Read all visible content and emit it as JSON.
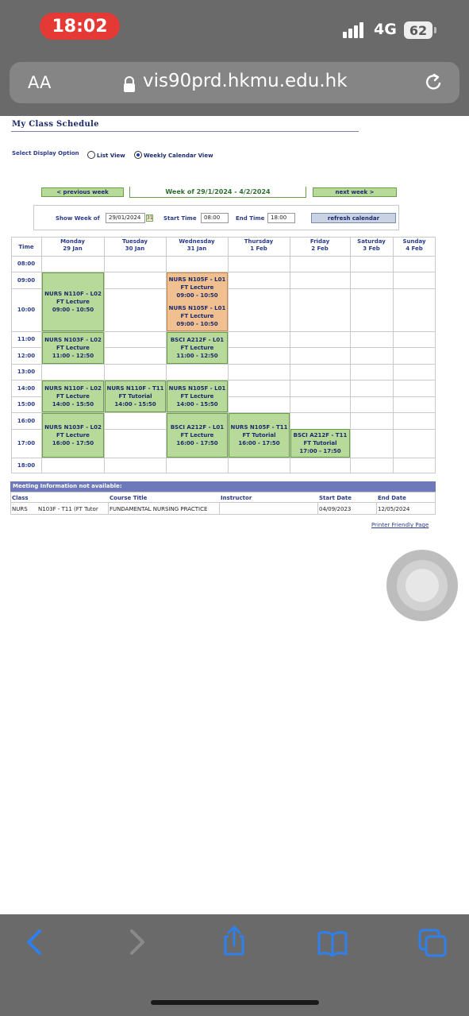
{
  "status_bar": {
    "time": "18:02",
    "network": "4G",
    "battery": "62"
  },
  "browser": {
    "text_size_label": "AA",
    "url": "vis90prd.hkmu.edu.hk"
  },
  "page": {
    "title": "My Class Schedule",
    "display_option_label": "Select Display Option",
    "list_view_label": "List View",
    "weekly_view_label": "Weekly Calendar View",
    "selected_view": "weekly",
    "prev_week_label": "< previous week",
    "week_label": "Week of 29/1/2024 - 4/2/2024",
    "next_week_label": "next week >",
    "show_week_label": "Show Week of",
    "show_week_value": "29/01/2024",
    "start_time_label": "Start Time",
    "start_time_value": "08:00",
    "end_time_label": "End Time",
    "end_time_value": "18:00",
    "refresh_label": "refresh calendar",
    "printer_label": "Printer Friendly Page"
  },
  "calendar": {
    "time_header": "Time",
    "days": [
      {
        "name": "Monday",
        "date": "29 Jan"
      },
      {
        "name": "Tuesday",
        "date": "30 Jan"
      },
      {
        "name": "Wednesday",
        "date": "31 Jan"
      },
      {
        "name": "Thursday",
        "date": "1 Feb"
      },
      {
        "name": "Friday",
        "date": "2 Feb"
      },
      {
        "name": "Saturday",
        "date": "3 Feb"
      },
      {
        "name": "Sunday",
        "date": "4 Feb"
      }
    ],
    "times": [
      "08:00",
      "09:00",
      "10:00",
      "11:00",
      "12:00",
      "13:00",
      "14:00",
      "15:00",
      "16:00",
      "17:00",
      "18:00"
    ],
    "events": [
      {
        "course": "NURS N110F - L02",
        "type": "FT Lecture",
        "time": "09:00 - 10:50"
      },
      {
        "course": "NURS N105F - L01",
        "type": "FT Lecture",
        "time": "09:00 - 10:50"
      },
      {
        "course": "NURS N105F - L01",
        "type": "FT Lecture",
        "time": "09:00 - 10:50"
      },
      {
        "course": "NURS N103F - L02",
        "type": "FT Lecture",
        "time": "11:00 - 12:50"
      },
      {
        "course": "BSCI A212F - L01",
        "type": "FT Lecture",
        "time": "11:00 - 12:50"
      },
      {
        "course": "NURS N110F - L02",
        "type": "FT Lecture",
        "time": "14:00 - 15:50"
      },
      {
        "course": "NURS N110F - T11",
        "type": "FT Tutorial",
        "time": "14:00 - 15:50"
      },
      {
        "course": "NURS N105F - L01",
        "type": "FT Lecture",
        "time": "14:00 - 15:50"
      },
      {
        "course": "NURS N103F - L02",
        "type": "FT Lecture",
        "time": "16:00 - 17:50"
      },
      {
        "course": "BSCI A212F - L01",
        "type": "FT Lecture",
        "time": "16:00 - 17:50"
      },
      {
        "course": "NURS N105F - T11",
        "type": "FT Tutorial",
        "time": "16:00 - 17:50"
      },
      {
        "course": "BSCI A212F - T11",
        "type": "FT Tutorial",
        "time": "17:00 - 17:50"
      }
    ],
    "colors": {
      "normal": "#b7d99a",
      "conflict": "#f0c090"
    }
  },
  "meeting": {
    "header": "Meeting Information not available:",
    "columns": [
      "Class",
      "Course Title",
      "Instructor",
      "Start Date",
      "End Date"
    ],
    "row": {
      "class_subject": "NURS",
      "class_code": "N103F - T11 (FT Tutor",
      "course_title": "FUNDAMENTAL NURSING PRACTICE",
      "instructor": "",
      "start_date": "04/09/2023",
      "end_date": "12/05/2024"
    }
  }
}
